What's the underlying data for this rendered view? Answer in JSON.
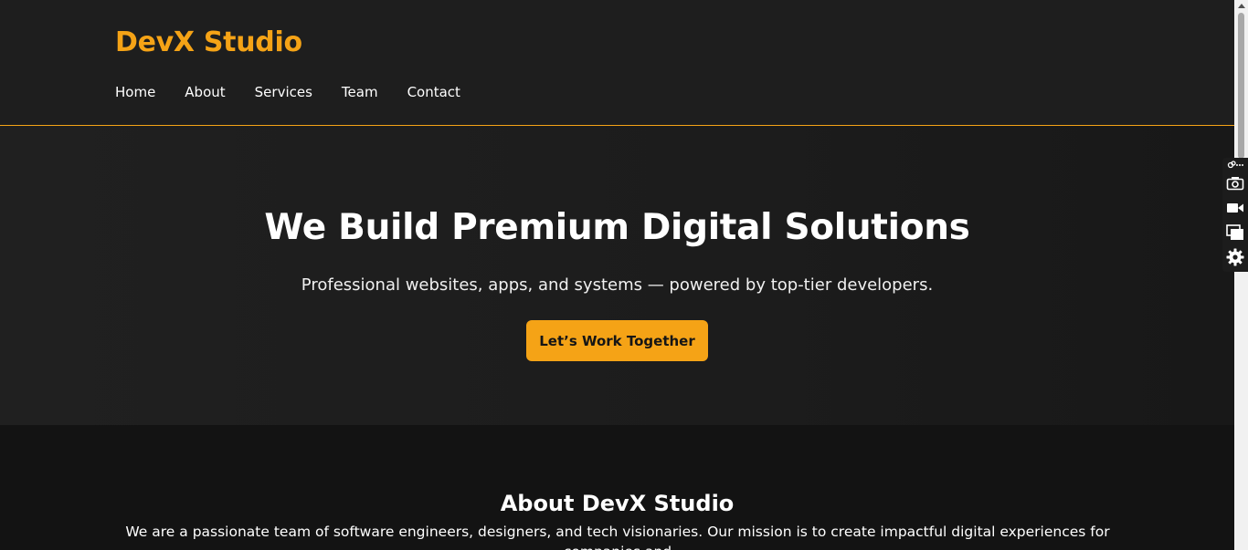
{
  "brand": {
    "name": "DevX Studio",
    "accent": "#f5a316"
  },
  "nav": {
    "items": [
      {
        "label": "Home"
      },
      {
        "label": "About"
      },
      {
        "label": "Services"
      },
      {
        "label": "Team"
      },
      {
        "label": "Contact"
      }
    ]
  },
  "hero": {
    "title": "We Build Premium Digital Solutions",
    "subtitle": "Professional websites, apps, and systems — powered by top-tier developers.",
    "cta_label": "Let’s Work Together"
  },
  "about": {
    "title": "About DevX Studio",
    "text": "We are a passionate team of software engineers, designers, and tech visionaries. Our mission is to create impactful digital experiences for companies and"
  },
  "extension_toolbar": {
    "icons": [
      "link-icon",
      "more-icon",
      "camera-icon",
      "video-camera-icon",
      "windows-icon",
      "gear-icon"
    ]
  }
}
